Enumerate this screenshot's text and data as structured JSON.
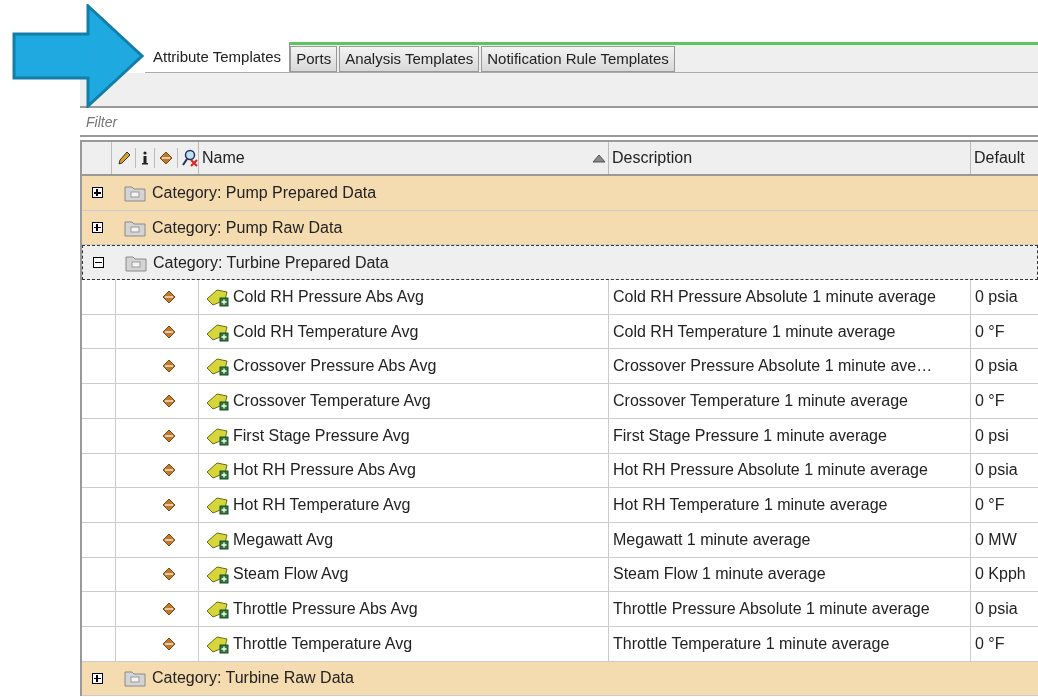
{
  "tabs": [
    {
      "label": "Attribute Templates",
      "selected": true
    },
    {
      "label": "Ports",
      "selected": false
    },
    {
      "label": "Analysis Templates",
      "selected": false
    },
    {
      "label": "Notification Rule Templates",
      "selected": false
    }
  ],
  "filter": {
    "placeholder": "Filter"
  },
  "table": {
    "columns": [
      {
        "label": "Name",
        "sorted": true
      },
      {
        "label": "Description",
        "sorted": false
      },
      {
        "label": "Default",
        "sorted": false
      }
    ],
    "categories": [
      {
        "label": "Category: Pump Prepared Data",
        "expanded": false,
        "selected": false
      },
      {
        "label": "Category: Pump Raw Data",
        "expanded": false,
        "selected": false
      },
      {
        "label": "Category: Turbine Prepared Data",
        "expanded": true,
        "selected": true,
        "children": [
          {
            "name": "Cold RH Pressure Abs Avg",
            "description": "Cold RH Pressure Absolute 1 minute average",
            "default": "0 psia"
          },
          {
            "name": "Cold RH Temperature Avg",
            "description": "Cold RH Temperature 1 minute average",
            "default": "0 °F"
          },
          {
            "name": "Crossover Pressure Abs Avg",
            "description": "Crossover Pressure Absolute 1 minute ave…",
            "default": "0 psia"
          },
          {
            "name": "Crossover Temperature Avg",
            "description": "Crossover Temperature 1 minute average",
            "default": "0 °F"
          },
          {
            "name": "First Stage Pressure Avg",
            "description": "First Stage Pressure 1 minute average",
            "default": "0 psi"
          },
          {
            "name": "Hot RH Pressure Abs Avg",
            "description": "Hot RH Pressure Absolute 1 minute average",
            "default": "0 psia"
          },
          {
            "name": "Hot RH Temperature Avg",
            "description": "Hot RH Temperature 1 minute average",
            "default": "0 °F"
          },
          {
            "name": "Megawatt Avg",
            "description": "Megawatt 1 minute average",
            "default": "0 MW"
          },
          {
            "name": "Steam Flow Avg",
            "description": "Steam Flow 1 minute average",
            "default": "0 Kpph"
          },
          {
            "name": "Throttle Pressure Abs Avg",
            "description": "Throttle Pressure Absolute 1 minute average",
            "default": "0 psia"
          },
          {
            "name": "Throttle Temperature Avg",
            "description": "Throttle Temperature 1 minute average",
            "default": "0 °F"
          }
        ]
      },
      {
        "label": "Category: Turbine Raw Data",
        "expanded": false,
        "selected": false
      }
    ]
  }
}
